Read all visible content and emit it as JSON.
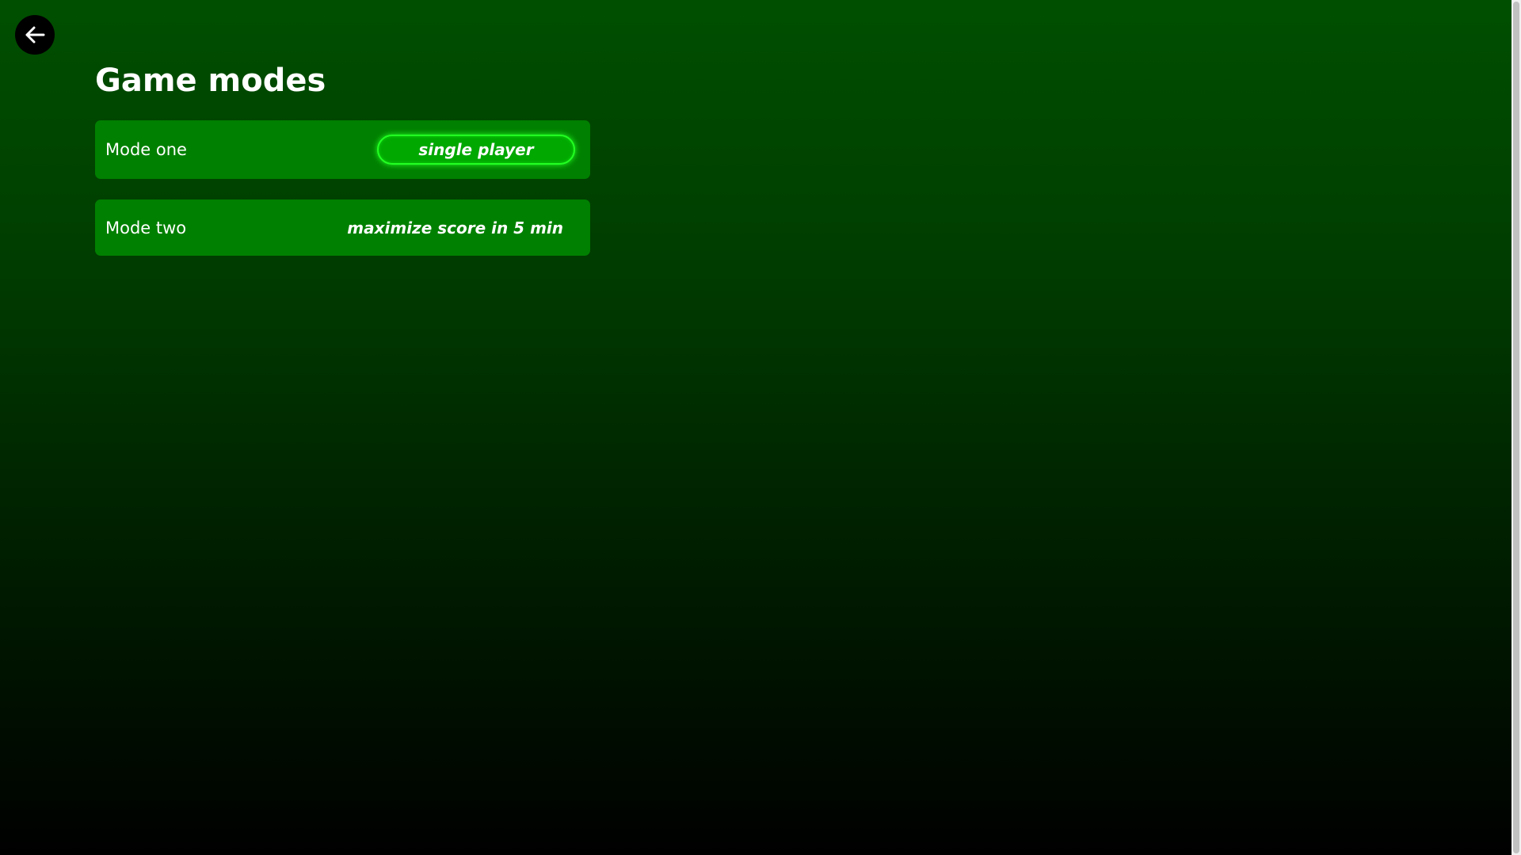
{
  "header": {
    "back_icon": "arrow-left-icon",
    "title": "Game modes"
  },
  "modes": [
    {
      "label": "Mode one",
      "description": "single player",
      "selected": true
    },
    {
      "label": "Mode two",
      "description": "maximize score in 5 min",
      "selected": false
    }
  ],
  "colors": {
    "background_top": "#004f00",
    "background_bottom": "#000000",
    "card": "#008000",
    "selected_pill": "#00a800",
    "selected_glow": "#22ff22"
  }
}
